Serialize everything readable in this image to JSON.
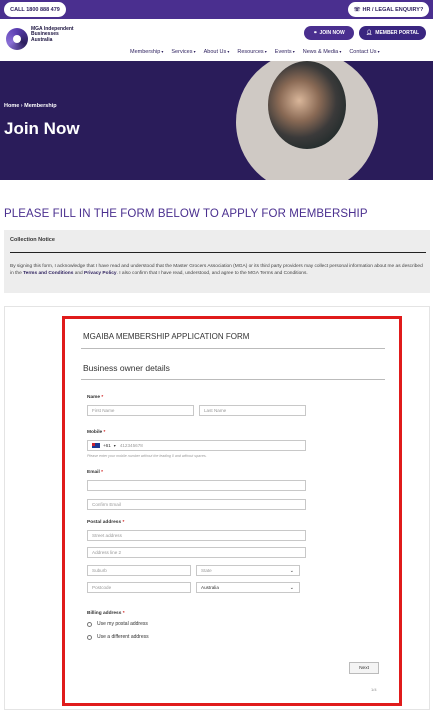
{
  "topbar": {
    "call_label": "CALL 1800 888 479",
    "hr_label": "HR / LEGAL ENQUIRY?"
  },
  "header": {
    "logo_text": "MGA Independent Businesses Australia",
    "join_label": "JOIN NOW",
    "portal_label": "MEMBER PORTAL",
    "nav": [
      "Membership",
      "Services",
      "About Us",
      "Resources",
      "Events",
      "News & Media",
      "Contact Us"
    ]
  },
  "hero": {
    "breadcrumb": "Home  ›  Membership",
    "title": "Join Now"
  },
  "page": {
    "heading": "PLEASE FILL IN THE FORM BELOW TO APPLY FOR MEMBERSHIP"
  },
  "notice": {
    "title": "Collection Notice",
    "text_a": "By signing this form, I acknowledge that I have read and understood that the Master Grocers Association (MGA) or its third  party providers may collect personal information about me as described in the ",
    "terms_link": "Terms and Conditions",
    "and": " and ",
    "privacy_link": "Privacy Policy",
    "text_b": ". I also confirm that I have read, understood, and agree to the MGA Terms and Conditions."
  },
  "form": {
    "title": "MGAIBA MEMBERSHIP APPLICATION FORM",
    "section": "Business owner details",
    "name_label": "Name",
    "first_name_ph": "First Name",
    "last_name_ph": "Last Name",
    "mobile_label": "Mobile",
    "country_code": "+61",
    "mobile_ph": "412345678",
    "mobile_hint": "Please enter your mobile number without the leading 0 and without spaces.",
    "email_label": "Email",
    "confirm_email_ph": "Confirm Email",
    "postal_label": "Postal address",
    "street_ph": "Street address",
    "line2_ph": "Address line 2",
    "suburb_ph": "Suburb",
    "state_ph": "State",
    "postcode_ph": "Postcode",
    "country_value": "Australia",
    "billing_label": "Billing address",
    "billing_option_1": "Use my postal address",
    "billing_option_2": "Use a different address",
    "next_label": "Next",
    "pager": "1/4"
  }
}
